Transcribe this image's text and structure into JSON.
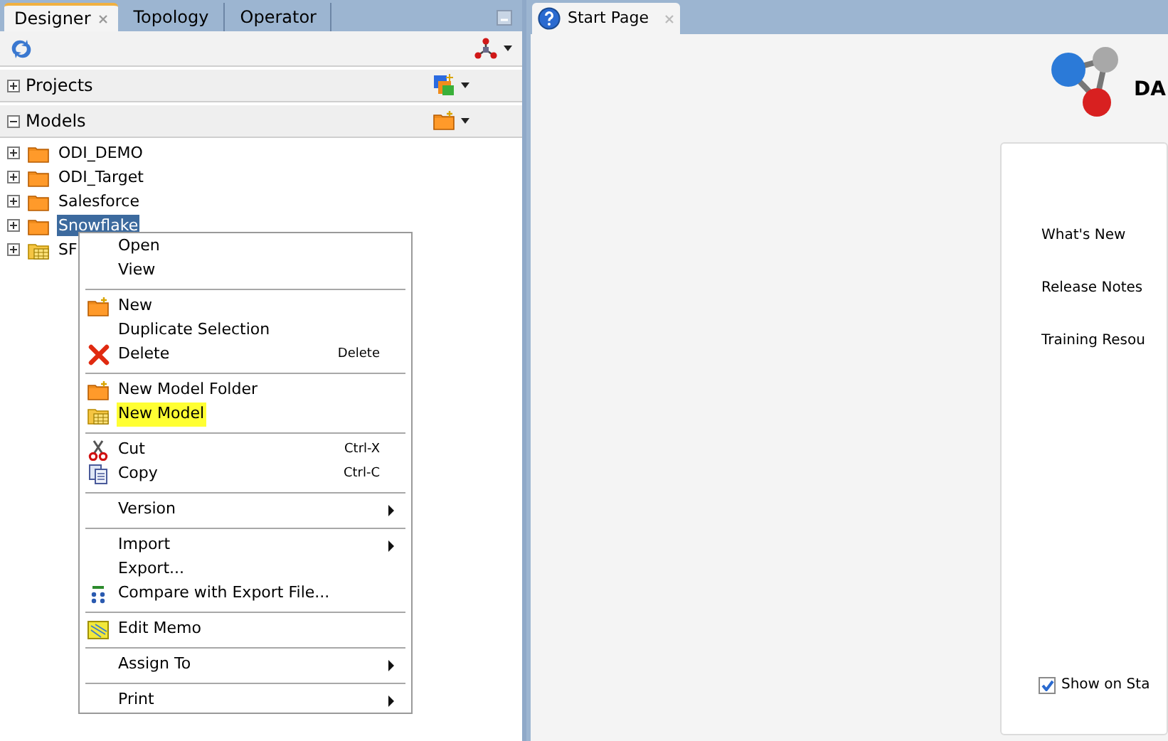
{
  "navigator_tabs": [
    {
      "label": "Designer",
      "selected": true,
      "closable": true
    },
    {
      "label": "Topology",
      "selected": false,
      "closable": false
    },
    {
      "label": "Operator",
      "selected": false,
      "closable": false
    }
  ],
  "accordions": [
    {
      "label": "Projects",
      "expanded": false
    },
    {
      "label": "Models",
      "expanded": true
    }
  ],
  "tree": [
    {
      "label": "ODI_DEMO",
      "selected": false
    },
    {
      "label": "ODI_Target",
      "selected": false
    },
    {
      "label": "Salesforce",
      "selected": false
    },
    {
      "label": "Snowflake",
      "selected": true
    },
    {
      "label": "SF",
      "selected": false
    }
  ],
  "context_menu": [
    {
      "kind": "item",
      "label": "Open"
    },
    {
      "kind": "item",
      "label": "View"
    },
    {
      "kind": "separator"
    },
    {
      "kind": "item",
      "label": "New"
    },
    {
      "kind": "item",
      "label": "Duplicate Selection"
    },
    {
      "kind": "item",
      "label": "Delete",
      "shortcut": "Delete"
    },
    {
      "kind": "separator"
    },
    {
      "kind": "item",
      "label": "New Model Folder"
    },
    {
      "kind": "item",
      "label": "New Model",
      "highlighted": true
    },
    {
      "kind": "separator"
    },
    {
      "kind": "item",
      "label": "Cut",
      "shortcut": "Ctrl-X"
    },
    {
      "kind": "item",
      "label": "Copy",
      "shortcut": "Ctrl-C"
    },
    {
      "kind": "separator"
    },
    {
      "kind": "submenu",
      "label": "Version"
    },
    {
      "kind": "separator"
    },
    {
      "kind": "submenu",
      "label": "Import"
    },
    {
      "kind": "item",
      "label": "Export..."
    },
    {
      "kind": "item",
      "label": "Compare with Export File..."
    },
    {
      "kind": "separator"
    },
    {
      "kind": "item",
      "label": "Edit Memo"
    },
    {
      "kind": "separator"
    },
    {
      "kind": "submenu",
      "label": "Assign To"
    },
    {
      "kind": "separator"
    },
    {
      "kind": "submenu",
      "label": "Print"
    }
  ],
  "editor_tab": {
    "label": "Start Page"
  },
  "start_page": {
    "title": "DA",
    "links": [
      "What's New",
      "Release Notes",
      "Training Resou"
    ],
    "show_on_startup": {
      "label": "Show on Sta",
      "checked": true
    }
  }
}
